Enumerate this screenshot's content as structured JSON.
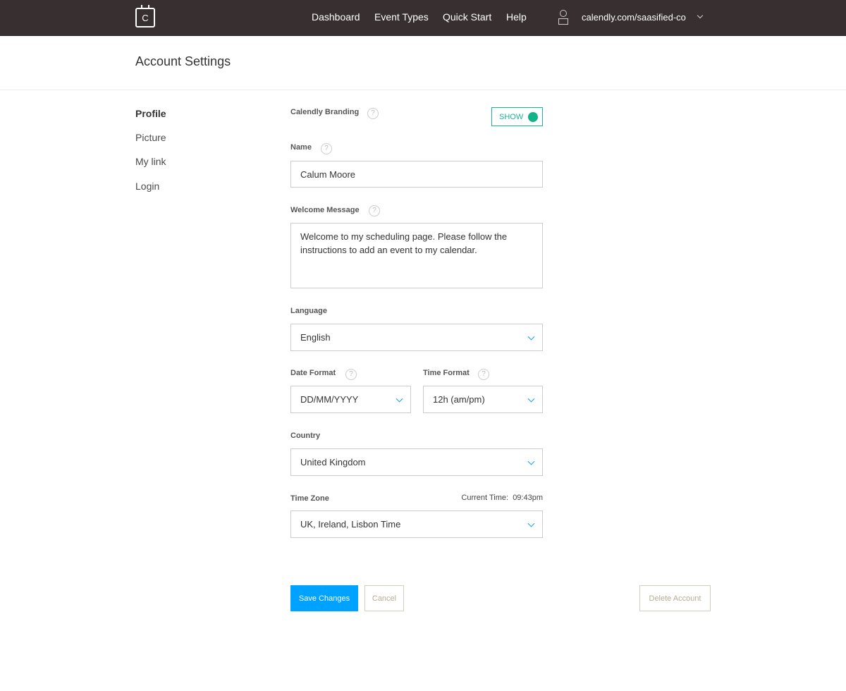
{
  "header": {
    "logo_letter": "C",
    "nav": [
      "Dashboard",
      "Event Types",
      "Quick Start",
      "Help"
    ],
    "account": "calendly.com/saasified-co"
  },
  "page_title": "Account Settings",
  "sidebar": {
    "items": [
      "Profile",
      "Picture",
      "My link",
      "Login"
    ],
    "active": "Profile"
  },
  "form": {
    "branding_label": "Calendly Branding",
    "branding_toggle": "SHOW",
    "branding_on": true,
    "name_label": "Name",
    "name_value": "Calum Moore",
    "welcome_label": "Welcome Message",
    "welcome_value": "Welcome to my scheduling page. Please follow the instructions to add an event to my calendar.",
    "language_label": "Language",
    "language_value": "English",
    "date_format_label": "Date Format",
    "date_format_value": "DD/MM/YYYY",
    "time_format_label": "Time Format",
    "time_format_value": "12h (am/pm)",
    "country_label": "Country",
    "country_value": "United Kingdom",
    "timezone_label": "Time Zone",
    "current_time_label": "Current Time:",
    "current_time": "09:43pm",
    "timezone_value": "UK, Ireland, Lisbon Time",
    "help": "?"
  },
  "actions": {
    "save": "Save Changes",
    "cancel": "Cancel",
    "delete": "Delete Account"
  },
  "colors": {
    "header": "#372f30",
    "primary": "#00a2ff",
    "toggle": "#12b386"
  }
}
